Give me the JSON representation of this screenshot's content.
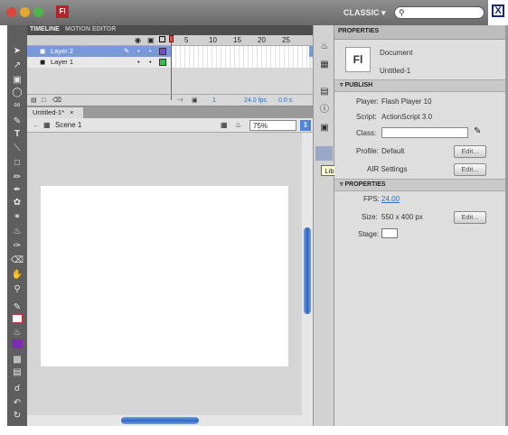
{
  "app": {
    "logo": "Fl",
    "workspace": "CLASSIC ▾",
    "search_placeholder": ""
  },
  "close_glyph": "X",
  "timeline": {
    "tabs": [
      "TIMELINE",
      "MOTION EDITOR"
    ],
    "frame_numbers": [
      "5",
      "10",
      "15",
      "20",
      "25"
    ],
    "layers": [
      {
        "name": "Layer 2",
        "selected": true,
        "color": "#7b4fc7"
      },
      {
        "name": "Layer 1",
        "selected": false,
        "color": "#36c04a"
      }
    ],
    "status": {
      "frame": "1",
      "fps": "24.0 fps",
      "time": "0.0 s"
    }
  },
  "document": {
    "tab": "Untitled-1*",
    "tab_close": "×",
    "scene": "Scene 1",
    "zoom": "75%"
  },
  "tooltip": "Library",
  "properties": {
    "tab": "PROPERTIES",
    "doc_icon": "Fl",
    "doc_type": "Document",
    "doc_name": "Untitled-1",
    "publish_header": "PUBLISH",
    "player_label": "Player:",
    "player_value": "Flash Player 10",
    "script_label": "Script:",
    "script_value": "ActionScript 3.0",
    "class_label": "Class:",
    "profile_label": "Profile:",
    "profile_value": "Default",
    "edit_label": "Edit...",
    "air_label": "AIR Settings",
    "props_header": "PROPERTIES",
    "fps_label": "FPS:",
    "fps_value": "24.00",
    "size_label": "Size:",
    "size_value": "550 x 400 px",
    "stage_label": "Stage:"
  }
}
